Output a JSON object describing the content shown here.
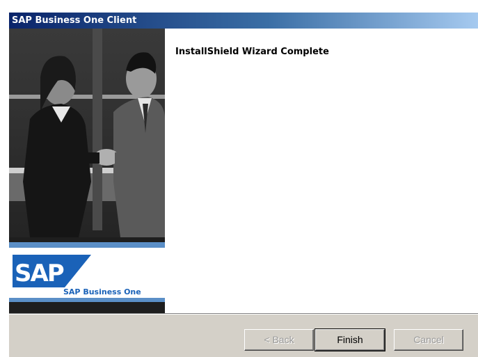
{
  "window": {
    "title": "SAP Business One Client"
  },
  "banner": {
    "logo_text": "SAP",
    "product_text": "SAP Business One",
    "colors": {
      "logo_blue": "#1a62b8",
      "band_blue": "#5b8fc7"
    }
  },
  "main": {
    "heading": "InstallShield Wizard Complete"
  },
  "buttons": {
    "back_label": "< Back",
    "finish_label": "Finish",
    "cancel_label": "Cancel"
  }
}
